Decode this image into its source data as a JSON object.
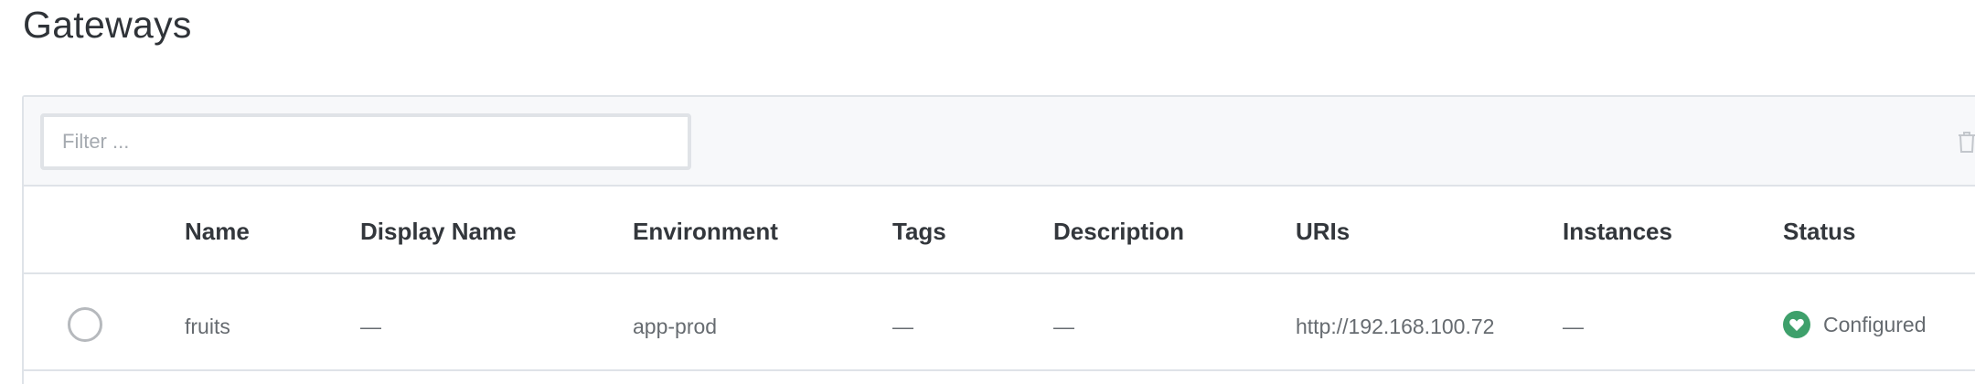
{
  "page": {
    "title": "Gateways"
  },
  "toolbar": {
    "filter_placeholder": "Filter ...",
    "filter_value": "",
    "delete_icon": "trash-icon"
  },
  "table": {
    "columns": [
      "Name",
      "Display Name",
      "Environment",
      "Tags",
      "Description",
      "URIs",
      "Instances",
      "Status"
    ],
    "rows": [
      {
        "selected": false,
        "name": "fruits",
        "display_name": "—",
        "environment": "app-prod",
        "tags": "—",
        "description": "—",
        "uris": "http://192.168.100.72",
        "instances": "—",
        "status": "Configured",
        "status_icon": "heart-icon",
        "status_color": "#3ea06b"
      }
    ]
  },
  "colors": {
    "border": "#dfe3e8",
    "toolbar_bg": "#f7f8fa",
    "text": "#2f3338",
    "muted_text": "#666b70",
    "status_ok": "#3ea06b"
  }
}
